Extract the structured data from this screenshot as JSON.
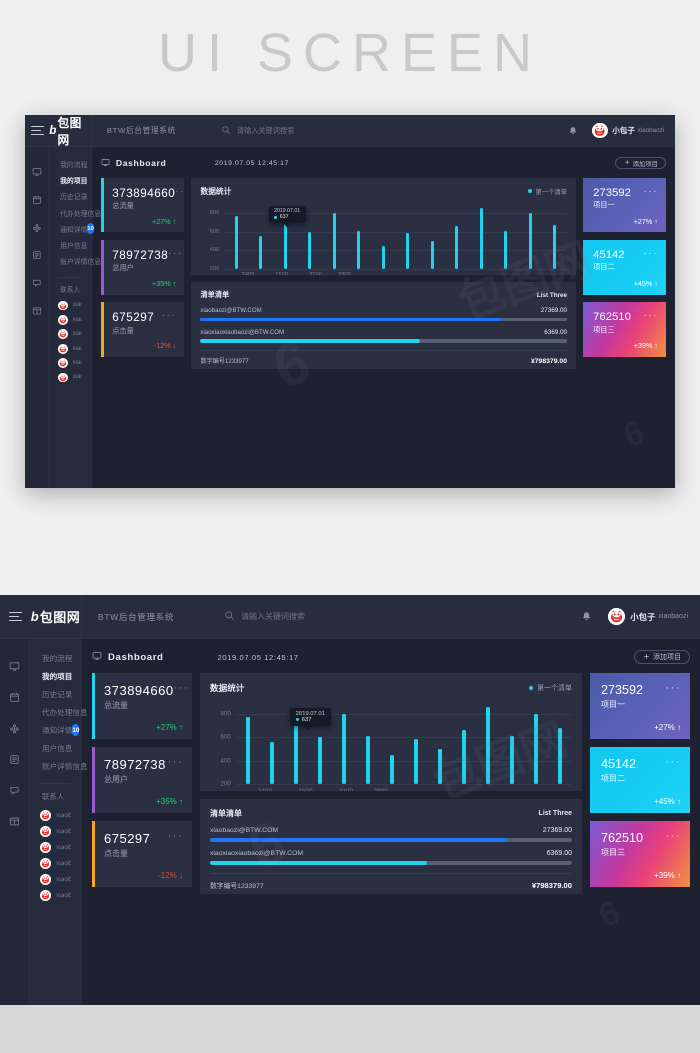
{
  "banner": {
    "title": "UI SCREEN"
  },
  "colors": {
    "page_bg": "#efeff0",
    "shell_bg": "#1e2130",
    "panel_bg": "#2a2f42",
    "topbar_bg": "#272c3e",
    "menu_bg": "#252a3c",
    "rail_bg": "#232739",
    "accent_cyan": "#22d3ee",
    "accent_purple": "#9b59d0",
    "accent_orange": "#f5a623",
    "accent_blue": "#1d74f5",
    "up_green": "#2ecc71",
    "down_red": "#e74c3c"
  },
  "header": {
    "menu_icon": "hamburger-icon",
    "logo_b": "b",
    "logo_text": "包图网",
    "system_title": "BTW后台管理系统",
    "search": {
      "icon": "search-icon",
      "placeholder": "请输入关键词搜索",
      "value": ""
    },
    "bell_icon": "bell-icon",
    "avatar_icon": "user-avatar",
    "user_name": "小包子",
    "user_handle": "xiaobaozi"
  },
  "rail": {
    "icons": [
      {
        "name": "monitor-icon"
      },
      {
        "name": "calendar-icon"
      },
      {
        "name": "puzzle-icon"
      },
      {
        "name": "list-icon"
      },
      {
        "name": "chat-icon"
      },
      {
        "name": "window-icon"
      }
    ]
  },
  "sidebar": {
    "items": [
      {
        "label": "我的流程",
        "active": false,
        "badge": ""
      },
      {
        "label": "我的项目",
        "active": true,
        "badge": ""
      },
      {
        "label": "历史记录",
        "active": false,
        "badge": ""
      },
      {
        "label": "代办处理信息",
        "active": false,
        "badge": ""
      },
      {
        "label": "通知详情",
        "active": false,
        "badge": "10"
      },
      {
        "label": "用户信息",
        "active": false,
        "badge": ""
      },
      {
        "label": "账户详情信息",
        "active": false,
        "badge": ""
      }
    ],
    "contacts_title": "联系人",
    "contacts": [
      {
        "name": "xiaobaozi"
      },
      {
        "name": "xiaobaozibaozi"
      },
      {
        "name": "xiaobaozi"
      },
      {
        "name": "xiaobaozibaozi"
      },
      {
        "name": "xiaobaozi"
      },
      {
        "name": "xiaobaozibaozi"
      }
    ]
  },
  "main": {
    "head_icon": "monitor-icon",
    "title": "Dashboard",
    "timestamp": "2019.07.05  12:45:17",
    "add_button": {
      "icon": "plus-icon",
      "label": "添加项目"
    }
  },
  "stats": [
    {
      "value": "373894660",
      "label": "总流量",
      "delta": "+27%",
      "direction": "up",
      "accent": "#22d3ee",
      "dots": "···"
    },
    {
      "value": "78972738",
      "label": "总用户",
      "delta": "+35%",
      "direction": "up",
      "accent": "#9b59d0",
      "dots": "···"
    },
    {
      "value": "675297",
      "label": "点击量",
      "delta": "-12%",
      "direction": "down",
      "accent": "#f5a623",
      "dots": "···"
    }
  ],
  "gradient_cards": [
    {
      "value": "273592",
      "label": "项目一",
      "delta": "+27%",
      "direction": "up",
      "gradient": "linear-gradient(135deg,#4a5ba8 0%,#5b61b8 55%,#6f63bf 100%)",
      "dots": "···"
    },
    {
      "value": "45142",
      "label": "项目二",
      "delta": "+45%",
      "direction": "up",
      "gradient": "linear-gradient(135deg,#12c8f0 0%,#16ccf3 60%,#1fd3f7 100%)",
      "dots": "···"
    },
    {
      "value": "762510",
      "label": "项目三",
      "delta": "+39%",
      "direction": "up",
      "gradient": "linear-gradient(120deg,#7b5bd6 0%,#c2399f 40%,#e8417a 62%,#f2903f 100%)",
      "dots": "···"
    }
  ],
  "list_panel": {
    "title": "清单清单",
    "right_label": "List Three",
    "rows": [
      {
        "name": "xiaobaozi@BTW.COM",
        "value": "27369.00",
        "percent": 82,
        "color": "#1d74f5"
      },
      {
        "name": "xiaoxiaoxiaobaozi@BTW.COM",
        "value": "6369.00",
        "percent": 60,
        "color": "#22d3ee"
      }
    ],
    "footer": {
      "name": "数字编号1233977",
      "value": "¥798379.00"
    }
  },
  "chart_data": {
    "type": "bar",
    "title": "数据统计",
    "legend": [
      "第一个清单"
    ],
    "legend_position": "top-right",
    "grid": true,
    "xlabel": "",
    "ylabel": "",
    "ylim": [
      200,
      900
    ],
    "yticks": [
      200,
      400,
      600,
      800
    ],
    "x_tick_labels": [
      "2400",
      "1500",
      "3100",
      "2800"
    ],
    "x_tick_positions": [
      2.5,
      6.0,
      9.5,
      12.5
    ],
    "bar_color": "#22d3ee",
    "categories": [
      "1",
      "2",
      "3",
      "4",
      "5",
      "6",
      "7",
      "8",
      "9",
      "10",
      "11",
      "12",
      "13",
      "14"
    ],
    "values": [
      770,
      555,
      725,
      600,
      800,
      610,
      450,
      585,
      495,
      665,
      855,
      608,
      800,
      675
    ],
    "annotation": {
      "date": "2019.07.01",
      "value": "637",
      "attached_to_bar": 5
    }
  },
  "watermarks": {
    "text_cn": "包图网",
    "text_num": "6"
  }
}
